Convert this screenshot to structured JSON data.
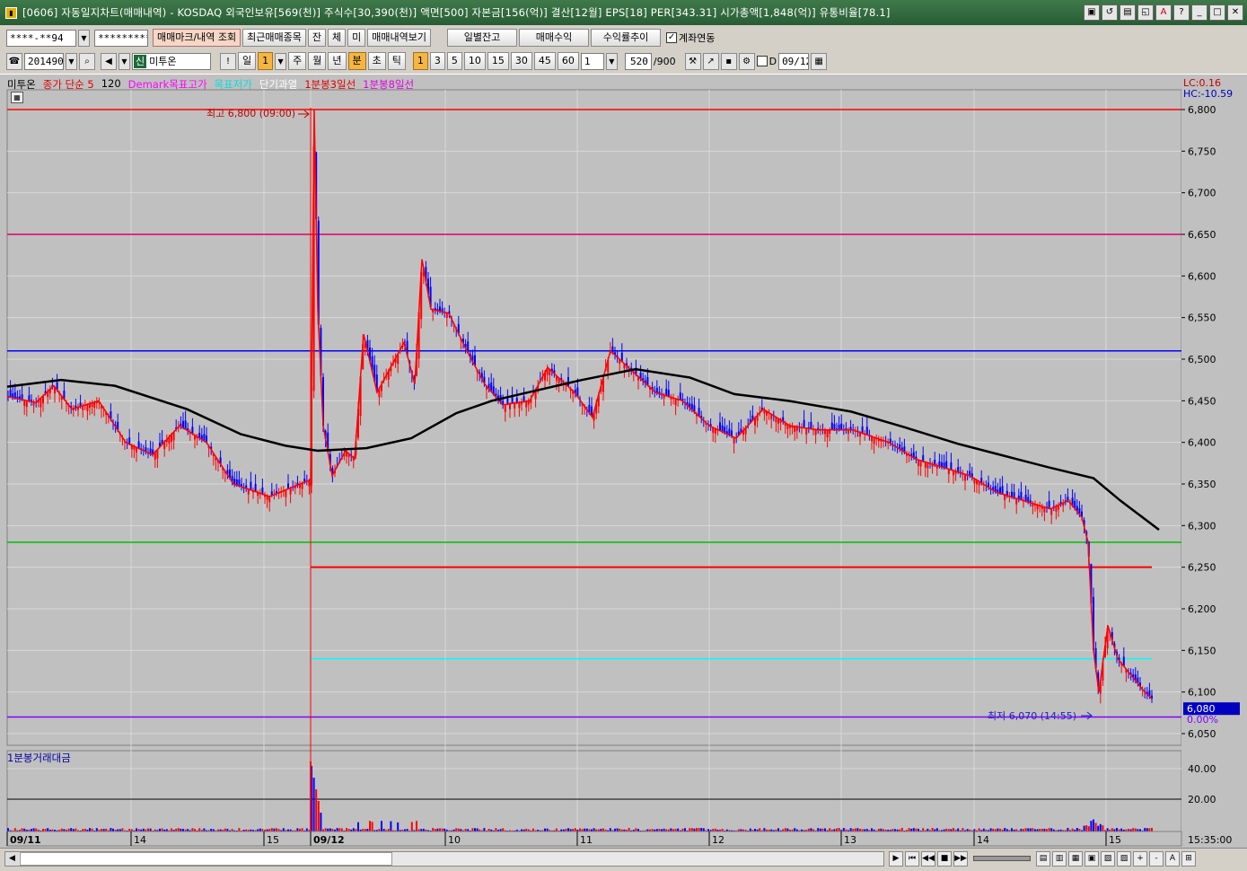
{
  "window": {
    "title": "[0606] 자동일지차트(매매내역) - KOSDAQ 외국인보유[569(천)] 주식수[30,390(천)] 액면[500] 자본금[156(억)] 결산[12월] EPS[18] PER[343.31] 시가총액[1,848(억)] 유통비율[78.1]",
    "controls": [
      "▣",
      "↺",
      "▤",
      "◱",
      "A",
      "?",
      "_",
      "□",
      "✕"
    ]
  },
  "toolbar1": {
    "account": "****-**94",
    "password": "*********",
    "btn_mark_lookup": "매매마크/내역 조회",
    "btn_recent": "최근매매종목",
    "btn_jan": "잔",
    "btn_che": "체",
    "btn_mi": "미",
    "btn_history": "매매내역보기",
    "btn_daily_balance": "일별잔고",
    "btn_trade_profit": "매매수익",
    "btn_return_trend": "수익률추이",
    "link_label": "계좌연동"
  },
  "toolbar2": {
    "code": "201490",
    "market_badge": "신",
    "stock_name": "미투온",
    "period_day": "일",
    "period_num": "1",
    "periods": [
      "주",
      "월",
      "년",
      "분",
      "초",
      "틱"
    ],
    "intervals": [
      "1",
      "3",
      "5",
      "10",
      "15",
      "30",
      "45",
      "60"
    ],
    "interval_input": "1",
    "count": "520",
    "count_max": "/900",
    "date_check": "D",
    "date": "09/12"
  },
  "legend": {
    "items": [
      {
        "text": "미투온",
        "color": "#000000"
      },
      {
        "text": "종가 단순 5",
        "color": "#ff0000"
      },
      {
        "text": "120",
        "color": "#000000"
      },
      {
        "text": "Demark목표고가",
        "color": "#ff00ff"
      },
      {
        "text": "목표저가",
        "color": "#00ffff"
      },
      {
        "text": "단기과열",
        "color": "#ffffff"
      },
      {
        "text": "1분봉3일선",
        "color": "#ff0000"
      },
      {
        "text": "1분봉8일선",
        "color": "#ff00ff"
      }
    ],
    "lc": "LC:0.16",
    "hc": "HC:-10.59"
  },
  "chart_data": {
    "type": "candlestick",
    "price_axis": {
      "ylim": [
        6050,
        6800
      ],
      "ticks": [
        "6,800",
        "6,750",
        "6,700",
        "6,650",
        "6,600",
        "6,550",
        "6,500",
        "6,450",
        "6,400",
        "6,350",
        "6,300",
        "6,250",
        "6,200",
        "6,150",
        "6,100",
        "6,050"
      ]
    },
    "x_labels": [
      "09/11",
      "14",
      "15",
      "09/12",
      "10",
      "11",
      "12",
      "13",
      "14",
      "15"
    ],
    "time_label": "15:35:00",
    "high_annotation": "최고 6,800 (09:00)",
    "low_annotation": "최저 6,070 (14:55)",
    "current_price": "6,080",
    "current_pct": "0.00%",
    "levels": [
      {
        "name": "최고",
        "value": 6800,
        "color": "#ff0000"
      },
      {
        "name": "Demark목표고가",
        "value": 6650,
        "color": "#e0006a"
      },
      {
        "name": "blue level",
        "value": 6510,
        "color": "#0000ff"
      },
      {
        "name": "green level",
        "value": 6280,
        "color": "#00c000"
      },
      {
        "name": "1분봉3일선",
        "value": 6250,
        "color": "#ff0000"
      },
      {
        "name": "목표저가",
        "value": 6140,
        "color": "#00ffff"
      },
      {
        "name": "최저",
        "value": 6070,
        "color": "#8000ff"
      }
    ],
    "ma120": [
      [
        0,
        6467
      ],
      [
        60,
        6475
      ],
      [
        120,
        6468
      ],
      [
        200,
        6440
      ],
      [
        260,
        6410
      ],
      [
        310,
        6396
      ],
      [
        346,
        6390
      ],
      [
        400,
        6393
      ],
      [
        450,
        6405
      ],
      [
        500,
        6435
      ],
      [
        540,
        6450
      ],
      [
        600,
        6465
      ],
      [
        640,
        6475
      ],
      [
        700,
        6488
      ],
      [
        760,
        6478
      ],
      [
        810,
        6458
      ],
      [
        870,
        6450
      ],
      [
        940,
        6437
      ],
      [
        1000,
        6418
      ],
      [
        1060,
        6398
      ],
      [
        1110,
        6384
      ],
      [
        1160,
        6370
      ],
      [
        1210,
        6357
      ],
      [
        1240,
        6330
      ],
      [
        1283,
        6295
      ]
    ],
    "close_series": [
      [
        8,
        6455
      ],
      [
        40,
        6448
      ],
      [
        60,
        6468
      ],
      [
        80,
        6440
      ],
      [
        110,
        6450
      ],
      [
        140,
        6400
      ],
      [
        170,
        6385
      ],
      [
        200,
        6420
      ],
      [
        230,
        6400
      ],
      [
        260,
        6350
      ],
      [
        300,
        6335
      ],
      [
        330,
        6348
      ],
      [
        346,
        6355
      ],
      [
        350,
        6800
      ],
      [
        354,
        6560
      ],
      [
        360,
        6420
      ],
      [
        370,
        6360
      ],
      [
        385,
        6390
      ],
      [
        395,
        6380
      ],
      [
        405,
        6530
      ],
      [
        420,
        6460
      ],
      [
        435,
        6490
      ],
      [
        450,
        6520
      ],
      [
        462,
        6470
      ],
      [
        470,
        6620
      ],
      [
        480,
        6560
      ],
      [
        500,
        6555
      ],
      [
        520,
        6510
      ],
      [
        540,
        6470
      ],
      [
        560,
        6445
      ],
      [
        590,
        6450
      ],
      [
        610,
        6490
      ],
      [
        640,
        6460
      ],
      [
        660,
        6430
      ],
      [
        680,
        6510
      ],
      [
        700,
        6490
      ],
      [
        730,
        6460
      ],
      [
        760,
        6450
      ],
      [
        790,
        6420
      ],
      [
        820,
        6405
      ],
      [
        850,
        6440
      ],
      [
        880,
        6420
      ],
      [
        910,
        6415
      ],
      [
        950,
        6415
      ],
      [
        990,
        6400
      ],
      [
        1020,
        6380
      ],
      [
        1050,
        6370
      ],
      [
        1080,
        6360
      ],
      [
        1110,
        6340
      ],
      [
        1140,
        6330
      ],
      [
        1170,
        6320
      ],
      [
        1190,
        6330
      ],
      [
        1205,
        6310
      ],
      [
        1212,
        6280
      ],
      [
        1218,
        6150
      ],
      [
        1224,
        6100
      ],
      [
        1234,
        6180
      ],
      [
        1245,
        6140
      ],
      [
        1260,
        6120
      ],
      [
        1275,
        6100
      ],
      [
        1283,
        6092
      ]
    ],
    "volume_axis": {
      "ticks": [
        "40.00",
        "20.00"
      ]
    },
    "volume_label": "1분봉거래대금"
  }
}
